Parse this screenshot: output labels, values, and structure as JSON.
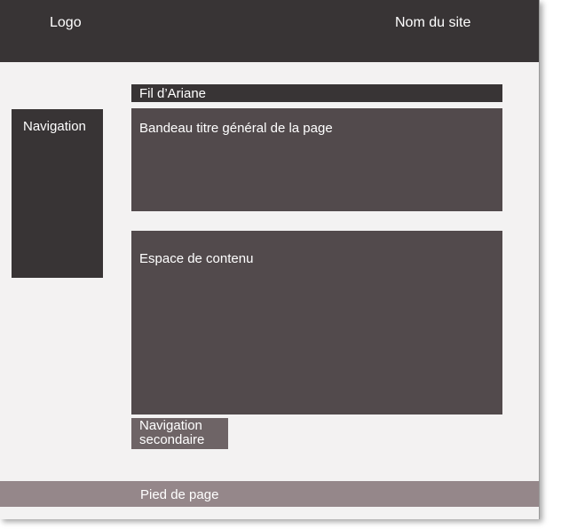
{
  "header": {
    "logo": "Logo",
    "site_name": "Nom du site"
  },
  "navigation": {
    "label": "Navigation"
  },
  "breadcrumb": {
    "label": "Fil d’Ariane"
  },
  "banner": {
    "label": "Bandeau titre général de la page"
  },
  "content": {
    "label": "Espace de contenu"
  },
  "secondary_navigation": {
    "line1": "Navigation",
    "line2": "secondaire"
  },
  "footer": {
    "label": "Pied de page"
  },
  "colors": {
    "dark": "#383435",
    "medium": "#524a4c",
    "secondary": "#6e6466",
    "footer": "#95878a",
    "background": "#f3f2f2"
  }
}
